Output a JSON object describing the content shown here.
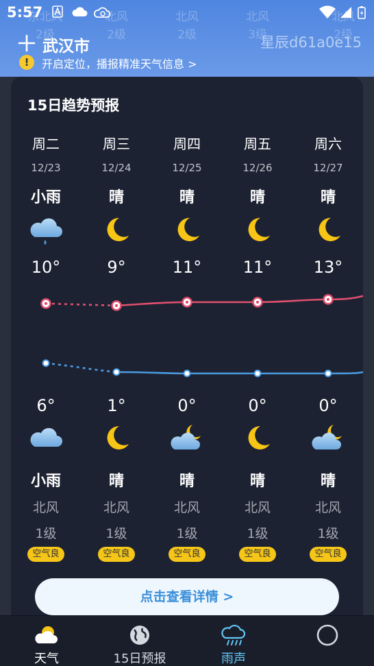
{
  "status_bar": {
    "time": "5:57"
  },
  "header": {
    "ghost_row": [
      {
        "dir": "东北风",
        "lvl": "2级"
      },
      {
        "dir": "北风",
        "lvl": "2级"
      },
      {
        "dir": "北风",
        "lvl": "2级"
      },
      {
        "dir": "北风",
        "lvl": "3级"
      },
      {
        "dir": "北风",
        "lvl": "2级"
      }
    ],
    "city": "武汉市",
    "watermark": "星辰d61a0e15",
    "hint": "开启定位，播报精准天气信息 >",
    "warn_glyph": "!"
  },
  "card": {
    "title": "15日趋势预报",
    "days": [
      {
        "weekday": "周二",
        "date": "12/23",
        "day_cond": "小雨",
        "day_icon": "rain-cloud-icon",
        "high": "10°",
        "low": "6°",
        "night_icon": "cloud-icon",
        "night_cond": "小雨",
        "wind_dir": "北风",
        "wind_lvl": "1级",
        "aqi": "空气良"
      },
      {
        "weekday": "周三",
        "date": "12/24",
        "day_cond": "晴",
        "day_icon": "moon-icon",
        "high": "9°",
        "low": "1°",
        "night_icon": "moon-icon",
        "night_cond": "晴",
        "wind_dir": "北风",
        "wind_lvl": "1级",
        "aqi": "空气良"
      },
      {
        "weekday": "周四",
        "date": "12/25",
        "day_cond": "晴",
        "day_icon": "moon-icon",
        "high": "11°",
        "low": "0°",
        "night_icon": "cloudy-moon-icon",
        "night_cond": "晴",
        "wind_dir": "北风",
        "wind_lvl": "1级",
        "aqi": "空气良"
      },
      {
        "weekday": "周五",
        "date": "12/26",
        "day_cond": "晴",
        "day_icon": "moon-icon",
        "high": "11°",
        "low": "0°",
        "night_icon": "moon-icon",
        "night_cond": "晴",
        "wind_dir": "北风",
        "wind_lvl": "1级",
        "aqi": "空气良"
      },
      {
        "weekday": "周六",
        "date": "12/27",
        "day_cond": "晴",
        "day_icon": "moon-icon",
        "high": "13°",
        "low": "0°",
        "night_icon": "cloudy-moon-icon",
        "night_cond": "晴",
        "wind_dir": "北风",
        "wind_lvl": "1级",
        "aqi": "空气良"
      }
    ],
    "detail_button": "点击查看详情 >"
  },
  "bottom_nav": [
    {
      "label": "天气",
      "icon": "sun-cloud-icon",
      "state": "active"
    },
    {
      "label": "15日预报",
      "icon": "globe-icon"
    },
    {
      "label": "雨声",
      "icon": "rain-sound-icon",
      "state": "selected"
    },
    {
      "label": "",
      "icon": "circle-icon"
    }
  ],
  "colors": {
    "header_blue": "#5a8fe4",
    "card_bg": "#1d2232",
    "high_line": "#e0506e",
    "low_line": "#4a9be0",
    "aqi_yellow": "#f5c518",
    "button_text": "#3b8fd9",
    "nav_selected": "#62c7f5"
  }
}
